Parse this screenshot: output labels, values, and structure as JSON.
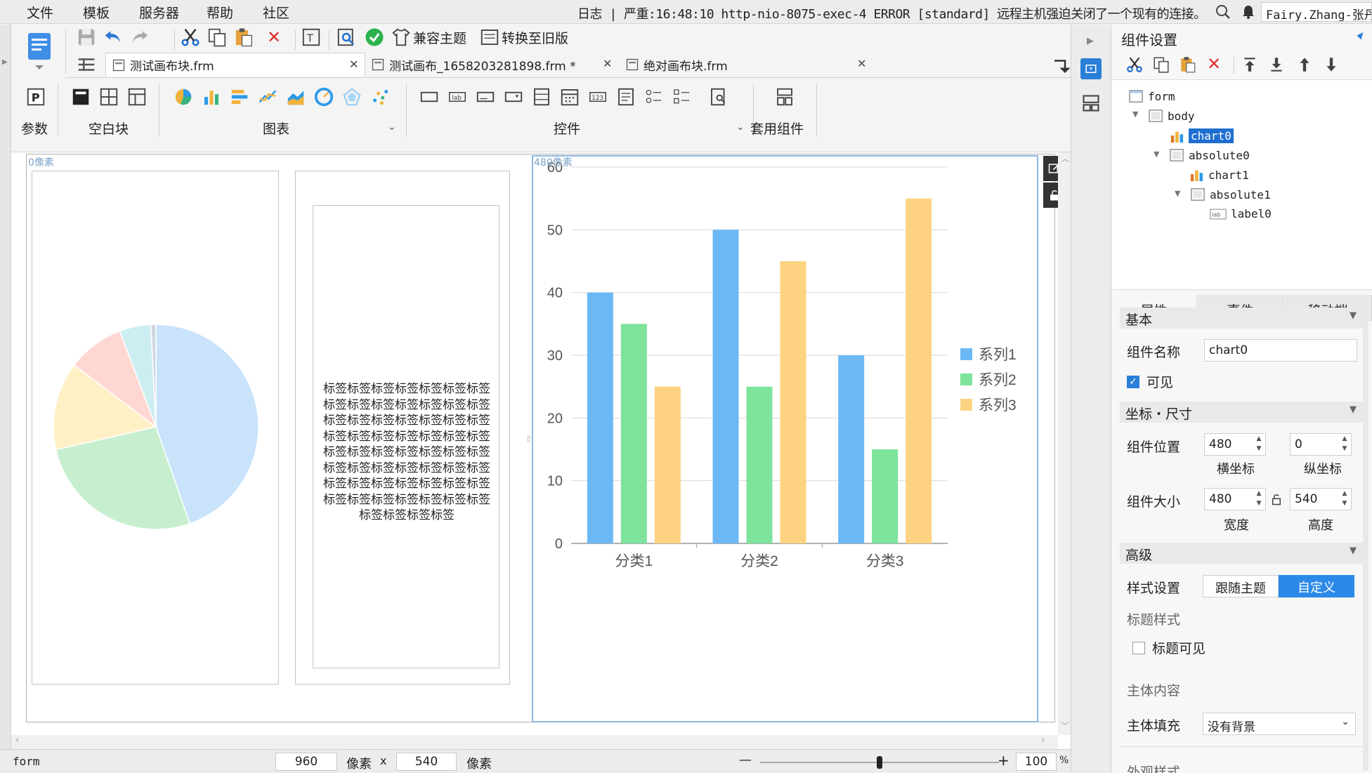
{
  "menu": {
    "items": [
      "文件",
      "模板",
      "服务器",
      "帮助",
      "社区"
    ]
  },
  "log": {
    "text": "日志 | 严重:16:48:10 http-nio-8075-exec-4 ERROR [standard] 远程主机强迫关闭了一个现有的连接。"
  },
  "user": {
    "name": "Fairy.Zhang-张丹"
  },
  "toolbar": {
    "compat_theme": "兼容主题",
    "convert_old": "转换至旧版",
    "groups": {
      "param": "参数",
      "blank": "空白块",
      "chart": "图表",
      "control": "控件",
      "widget": "套用组件"
    }
  },
  "tabs": [
    {
      "label": "测试画布块.frm",
      "close": "✕"
    },
    {
      "label": "测试画布_1658203281898.frm *",
      "close": "✕"
    },
    {
      "label": "绝对画布块.frm",
      "close": "✕"
    }
  ],
  "canvas": {
    "ruler_left": "0像素",
    "ruler_right": "480像素",
    "label_text": "标签标签标签标签标签标签标签标签标签标签标签标签标签标签标签标签标签标签标签标签标签标签标签标签标签标签标签标签标签标签标签标签标签标签标签标签标签标签标签标签标签标签标签标签标签标签标签标签标签标签标签标签标签标签标签标签标签标签标签标签"
  },
  "chart_data": [
    {
      "type": "pie",
      "values": [
        45,
        27,
        14,
        9,
        5,
        0.8
      ],
      "colors": [
        "#c9e3fb",
        "#c7efcf",
        "#fff0c6",
        "#ffd7d2",
        "#cdeef0",
        "#cfd6e2"
      ]
    },
    {
      "type": "bar",
      "categories": [
        "分类1",
        "分类2",
        "分类3"
      ],
      "series": [
        {
          "name": "系列1",
          "values": [
            40,
            50,
            30
          ],
          "color": "#6cb8f5"
        },
        {
          "name": "系列2",
          "values": [
            35,
            25,
            15
          ],
          "color": "#7ee39b"
        },
        {
          "name": "系列3",
          "values": [
            25,
            45,
            55
          ],
          "color": "#fdd382"
        }
      ],
      "ylim": [
        0,
        60
      ],
      "yticks": [
        "0",
        "10",
        "20",
        "30",
        "40",
        "50",
        "60"
      ],
      "legend_position": "right",
      "grid": true
    }
  ],
  "status": {
    "form": "form",
    "width": "960",
    "unit1": "像素",
    "times": "x",
    "height": "540",
    "unit2": "像素",
    "minus": "—",
    "plus": "+",
    "zoom": "100",
    "percent": "%",
    "zoom_level": 0.5
  },
  "panel": {
    "title": "组件设置",
    "tree": [
      {
        "label": "form"
      },
      {
        "label": "body"
      },
      {
        "label": "chart0"
      },
      {
        "label": "absolute0"
      },
      {
        "label": "chart1"
      },
      {
        "label": "absolute1"
      },
      {
        "label": "label0"
      }
    ],
    "tabs": [
      "属性",
      "事件",
      "移动端"
    ],
    "basic": "基本",
    "comp_name_label": "组件名称",
    "comp_name_value": "chart0",
    "visible_label": "可见",
    "coord_size": "坐标・尺寸",
    "position_label": "组件位置",
    "pos_x": "480",
    "pos_y": "0",
    "x_label": "横坐标",
    "y_label": "纵坐标",
    "size_label": "组件大小",
    "width": "480",
    "height": "540",
    "w_label": "宽度",
    "h_label": "高度",
    "advanced": "高级",
    "style_label": "样式设置",
    "follow_theme": "跟随主题",
    "custom": "自定义",
    "title_style": "标题样式",
    "title_visible": "标题可见",
    "main_content": "主体内容",
    "main_fill_label": "主体填充",
    "main_fill_value": "没有背景",
    "outer_style": "外观样式"
  }
}
